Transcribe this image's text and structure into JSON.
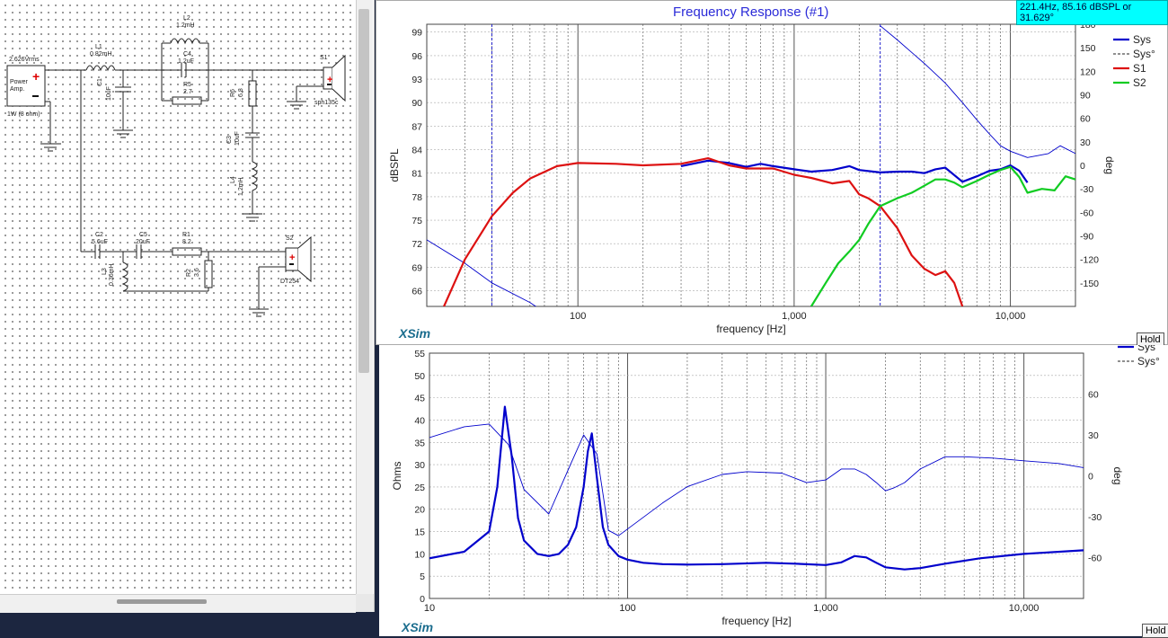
{
  "colors": {
    "sys": "#0000cc",
    "s1": "#dd1111",
    "s2": "#11cc22",
    "title": "#2b2bd8",
    "xsim": "#1b6d8e",
    "cursor_bg": "#00ffff"
  },
  "schematic": {
    "source": {
      "voltage": "2.626Vrms",
      "name": "Power Amp.",
      "power": "1W (8 ohm)"
    },
    "components": [
      {
        "id": "L1",
        "value": "0.82mH"
      },
      {
        "id": "C1",
        "value": "10uF"
      },
      {
        "id": "L2",
        "value": "1.2mH"
      },
      {
        "id": "C4",
        "value": "1.2uF"
      },
      {
        "id": "R5",
        "value": "2.7"
      },
      {
        "id": "R6",
        "value": "6.8"
      },
      {
        "id": "C3",
        "value": "10uF"
      },
      {
        "id": "L4",
        "value": "1.2mH"
      },
      {
        "id": "C2",
        "value": "5.6uF"
      },
      {
        "id": "C5",
        "value": "20uF"
      },
      {
        "id": "R1",
        "value": "8.2"
      },
      {
        "id": "L3",
        "value": "0.36mH"
      },
      {
        "id": "R2",
        "value": "3.6"
      }
    ],
    "drivers": {
      "s1": {
        "label": "S1",
        "model": "sph135c"
      },
      "s2": {
        "label": "S2",
        "model": "DT254"
      }
    }
  },
  "cursor_readout": "221.4Hz, 85.16 dBSPL or 31.629°",
  "fr_panel": {
    "title": "Frequency Response (#1)",
    "brand": "XSim",
    "hold": "Hold"
  },
  "imp_panel": {
    "brand": "XSim",
    "hold": "Hold"
  },
  "chart_data": [
    {
      "type": "line",
      "title": "Frequency Response (#1)",
      "xlabel": "frequency [Hz]",
      "ylabel": "dBSPL",
      "y2label": "deg",
      "xscale": "log",
      "xlim": [
        20,
        20000
      ],
      "ylim": [
        64,
        100
      ],
      "y2lim": [
        -180,
        180
      ],
      "xticks": [
        {
          "v": 100,
          "label": "100"
        },
        {
          "v": 1000,
          "label": "1,000"
        },
        {
          "v": 10000,
          "label": "10,000"
        }
      ],
      "yticks": [
        66,
        69,
        72,
        75,
        78,
        81,
        84,
        87,
        90,
        93,
        96,
        99
      ],
      "y2ticks": [
        180,
        150,
        120,
        90,
        60,
        30,
        0,
        -30,
        -60,
        -90,
        -120,
        -150
      ],
      "legend": [
        {
          "name": "Sys",
          "style": "solid",
          "color": "#0000cc"
        },
        {
          "name": "Sys°",
          "style": "dashed",
          "color": "#222"
        },
        {
          "name": "S1",
          "style": "solid",
          "color": "#dd1111"
        },
        {
          "name": "S2",
          "style": "solid",
          "color": "#11cc22"
        }
      ],
      "markers": [
        {
          "x": 40
        },
        {
          "x": 2500
        }
      ],
      "series": [
        {
          "name": "Sys",
          "axis": "left",
          "color": "#0000cc",
          "x": [
            300,
            400,
            500,
            600,
            700,
            800,
            1000,
            1200,
            1500,
            1800,
            2000,
            2500,
            3000,
            3500,
            4000,
            4500,
            5000,
            6000,
            7000,
            8000,
            9000,
            10000,
            11000,
            12000
          ],
          "y": [
            81.9,
            82.6,
            82.3,
            81.8,
            82.2,
            81.9,
            81.5,
            81.2,
            81.4,
            81.9,
            81.4,
            81.1,
            81.2,
            81.2,
            81.0,
            81.5,
            81.7,
            79.9,
            80.6,
            81.3,
            81.5,
            82.0,
            81.3,
            79.8
          ]
        },
        {
          "name": "Sys° phase",
          "axis": "right",
          "color": "#0000cc",
          "x": [
            20,
            30,
            40,
            60,
            80,
            100,
            150,
            200,
            300,
            400,
            600,
            800,
            1000,
            1500,
            2000,
            2500
          ],
          "y": [
            -95,
            -125,
            -150,
            -175,
            -198,
            -210,
            -232,
            -250,
            -268,
            -280,
            -300,
            -320,
            -345,
            -385,
            -430,
            -470
          ]
        },
        {
          "name": "Sys° phase (wrapped)",
          "axis": "right",
          "color": "#0000cc",
          "x": [
            2500,
            3000,
            4000,
            5000,
            6000,
            7000,
            8000,
            9000,
            10000,
            12000,
            15000,
            17000,
            20000
          ],
          "y": [
            178,
            160,
            130,
            105,
            80,
            58,
            40,
            25,
            18,
            10,
            15,
            25,
            15
          ]
        },
        {
          "name": "S1",
          "axis": "left",
          "color": "#dd1111",
          "x": [
            24,
            30,
            40,
            50,
            60,
            80,
            100,
            150,
            200,
            300,
            400,
            500,
            600,
            800,
            1000,
            1200,
            1500,
            1800,
            2000,
            2200,
            2500,
            3000,
            3500,
            4000,
            4500,
            5000,
            5500,
            6000
          ],
          "y": [
            64,
            70,
            75.5,
            78.5,
            80.3,
            81.9,
            82.3,
            82.2,
            82.0,
            82.2,
            82.9,
            82.0,
            81.6,
            81.6,
            80.8,
            80.4,
            79.7,
            80.0,
            78.3,
            77.8,
            76.8,
            74.0,
            70.5,
            68.8,
            68.0,
            68.5,
            67.0,
            64.0
          ]
        },
        {
          "name": "S2",
          "axis": "left",
          "color": "#11cc22",
          "x": [
            1200,
            1400,
            1600,
            1800,
            2000,
            2200,
            2500,
            3000,
            3500,
            4000,
            4500,
            5000,
            5500,
            6000,
            7000,
            8000,
            9000,
            10000,
            11000,
            12000,
            14000,
            16000,
            18000,
            20000
          ],
          "y": [
            64,
            67,
            69.5,
            71,
            72.5,
            74.5,
            76.8,
            77.8,
            78.5,
            79.4,
            80.2,
            80.2,
            79.8,
            79.2,
            80.0,
            80.8,
            81.4,
            81.8,
            80.5,
            78.5,
            79.0,
            78.8,
            80.6,
            80.2
          ]
        }
      ]
    },
    {
      "type": "line",
      "xlabel": "frequency [Hz]",
      "ylabel": "Ohms",
      "y2label": "deg",
      "xscale": "log",
      "xlim": [
        10,
        20000
      ],
      "ylim": [
        0,
        55
      ],
      "y2lim": [
        -90,
        90
      ],
      "xticks": [
        {
          "v": 10,
          "label": "10"
        },
        {
          "v": 100,
          "label": "100"
        },
        {
          "v": 1000,
          "label": "1,000"
        },
        {
          "v": 10000,
          "label": "10,000"
        }
      ],
      "yticks": [
        0,
        5,
        10,
        15,
        20,
        25,
        30,
        35,
        40,
        45,
        50,
        55
      ],
      "y2ticks": [
        60,
        30,
        0,
        -30,
        -60
      ],
      "legend": [
        {
          "name": "Sys",
          "style": "solid",
          "color": "#0000cc"
        },
        {
          "name": "Sys°",
          "style": "dashed",
          "color": "#222"
        }
      ],
      "series": [
        {
          "name": "Sys",
          "axis": "left",
          "color": "#0000cc",
          "x": [
            10,
            15,
            20,
            22,
            24,
            26,
            28,
            30,
            35,
            40,
            45,
            50,
            55,
            60,
            63,
            66,
            70,
            75,
            80,
            90,
            100,
            120,
            150,
            200,
            300,
            500,
            700,
            1000,
            1200,
            1400,
            1600,
            1800,
            2000,
            2500,
            3000,
            4000,
            6000,
            10000,
            20000
          ],
          "y": [
            9,
            10.5,
            15,
            25,
            43,
            32,
            18,
            13,
            10,
            9.5,
            10,
            12,
            16,
            25,
            33,
            37,
            27,
            16,
            12,
            9.5,
            8.7,
            8,
            7.7,
            7.6,
            7.7,
            8,
            7.8,
            7.5,
            8.1,
            9.5,
            9.2,
            8,
            7,
            6.5,
            6.8,
            7.8,
            9,
            10,
            10.8
          ]
        },
        {
          "name": "Sys phase",
          "axis": "right",
          "color": "#0000cc",
          "x": [
            10,
            15,
            20,
            25,
            30,
            40,
            50,
            60,
            70,
            80,
            90,
            100,
            150,
            200,
            300,
            400,
            600,
            800,
            1000,
            1200,
            1400,
            1600,
            1800,
            2000,
            2200,
            2500,
            3000,
            4000,
            5000,
            7000,
            10000,
            15000,
            20000
          ],
          "y": [
            28,
            36,
            38,
            23,
            -10,
            -28,
            4,
            30,
            16,
            -40,
            -44,
            -39,
            -20,
            -8,
            1,
            3,
            2,
            -5,
            -3,
            5,
            5,
            1,
            -5,
            -11,
            -9,
            -5,
            5,
            14,
            14,
            13,
            11,
            9,
            6
          ]
        }
      ]
    }
  ]
}
